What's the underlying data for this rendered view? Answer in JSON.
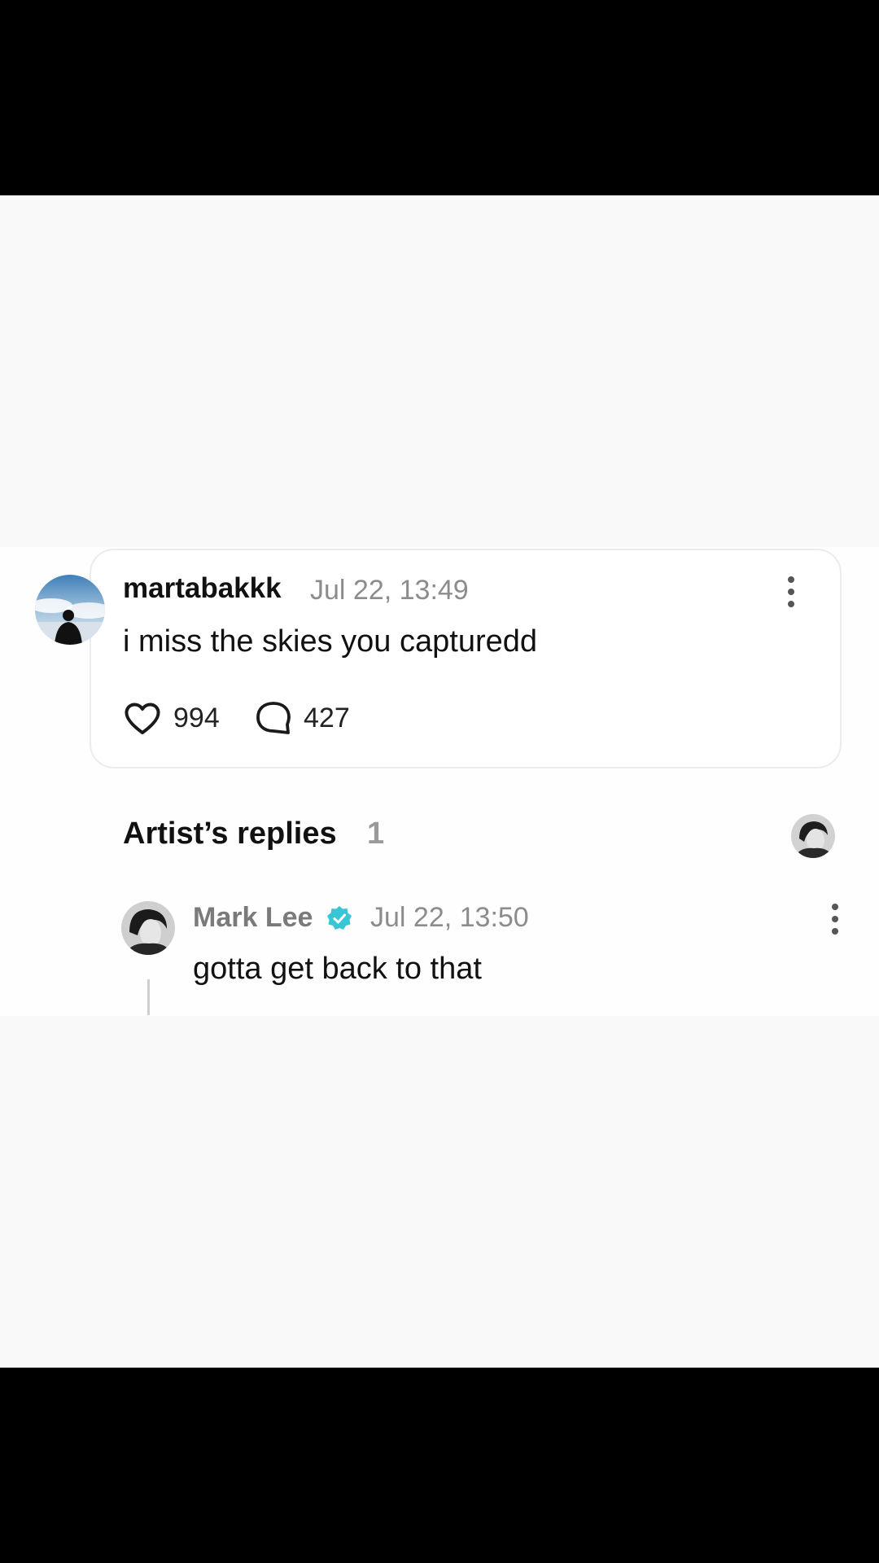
{
  "comment": {
    "avatar_icon": "user-silhouette-sky-avatar",
    "username": "martabakkk",
    "timestamp": "Jul 22, 13:49",
    "text": "i miss the skies you capturedd",
    "likes": "994",
    "replies": "427",
    "more_icon": "vertical-ellipsis-icon"
  },
  "artist_replies": {
    "title": "Artist’s replies",
    "count": "1",
    "avatar_icon": "artist-avatar"
  },
  "reply": {
    "name": "Mark Lee",
    "verified_icon": "verified-badge-icon",
    "timestamp": "Jul 22, 13:50",
    "text": "gotta get back to that",
    "more_icon": "vertical-ellipsis-icon"
  },
  "colors": {
    "verified": "#38c6d6",
    "timestamp": "#8c8c8c",
    "background": "#f9f9f9",
    "letterbox": "#000000"
  }
}
